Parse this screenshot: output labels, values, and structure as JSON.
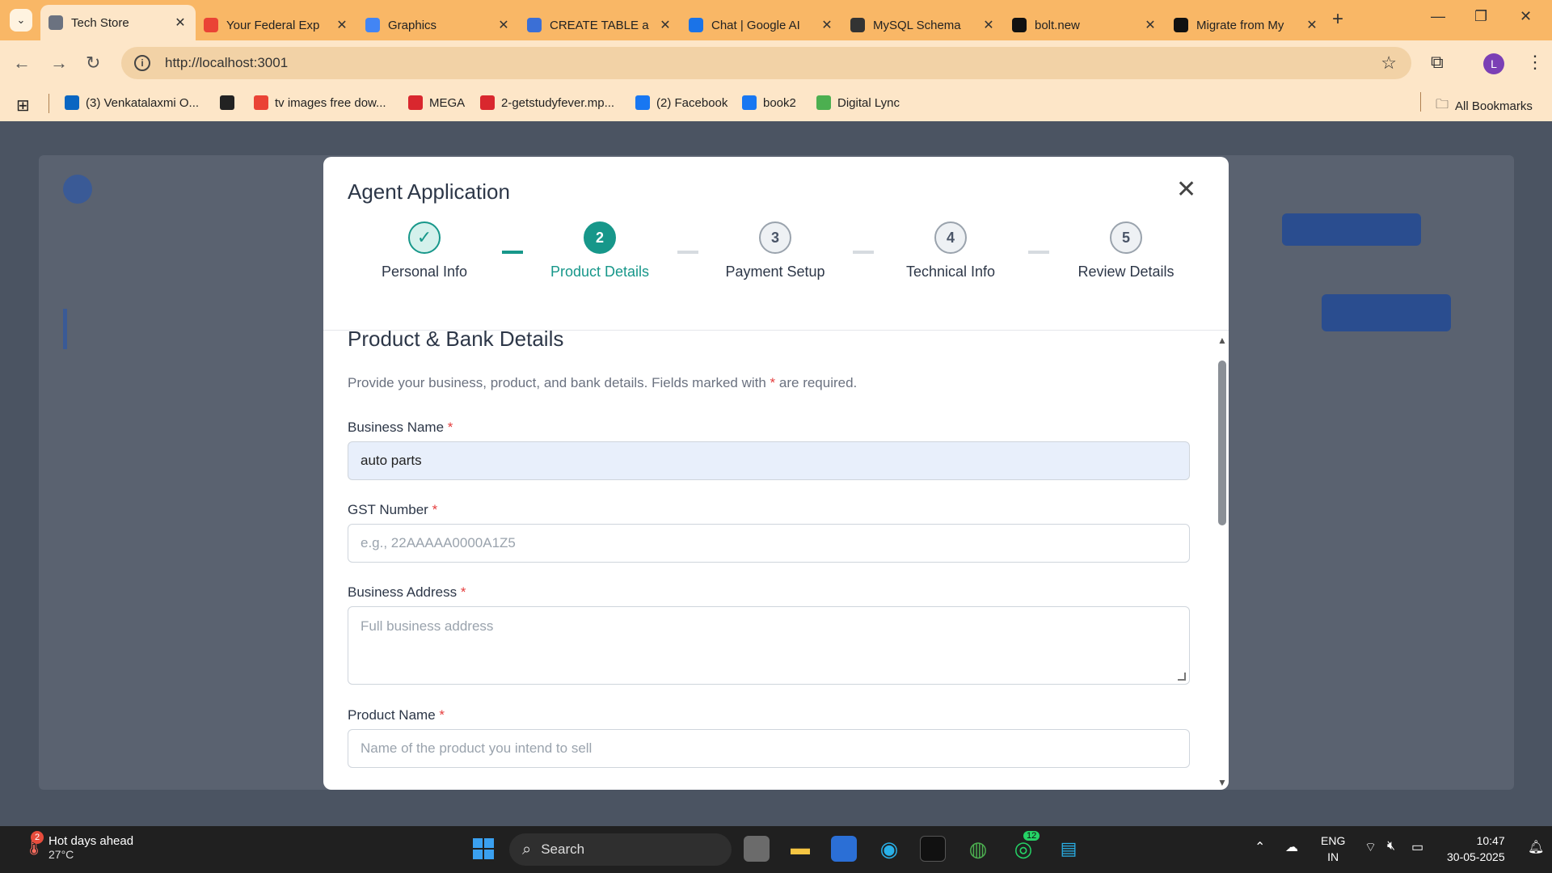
{
  "browser": {
    "tabs": [
      {
        "title": "Tech Store",
        "favicon": "globe-icon",
        "color": "#6b7280",
        "active": true
      },
      {
        "title": "Your Federal Exp",
        "favicon": "gmail-icon",
        "color": "#ea4335",
        "active": false
      },
      {
        "title": "Graphics",
        "favicon": "colab-icon",
        "color": "#4285f4",
        "active": false
      },
      {
        "title": "CREATE TABLE a",
        "favicon": "bot-icon",
        "color": "#3b6fd6",
        "active": false
      },
      {
        "title": "Chat | Google AI",
        "favicon": "butterfly-icon",
        "color": "#1a73e8",
        "active": false
      },
      {
        "title": "MySQL Schema",
        "favicon": "openai-icon",
        "color": "#333333",
        "active": false
      },
      {
        "title": "bolt.new",
        "favicon": "bolt-icon",
        "color": "#111111",
        "active": false
      },
      {
        "title": "Migrate from My",
        "favicon": "bolt-icon",
        "color": "#111111",
        "active": false
      }
    ],
    "url": "http://localhost:3001",
    "profile_initial": "L",
    "bookmarks": [
      {
        "label": "(3) Venkatalaxmi O...",
        "icon": "linkedin-icon",
        "color": "#0a66c2"
      },
      {
        "label": "",
        "icon": "globe-icon",
        "color": "#222222"
      },
      {
        "label": "tv images free dow...",
        "icon": "google-icon",
        "color": "#ea4335"
      },
      {
        "label": "MEGA",
        "icon": "mega-icon",
        "color": "#d9272e"
      },
      {
        "label": "2-getstudyfever.mp...",
        "icon": "mega-icon",
        "color": "#d9272e"
      },
      {
        "label": "(2) Facebook",
        "icon": "facebook-icon",
        "color": "#1877f2"
      },
      {
        "label": "book2",
        "icon": "facebook-icon",
        "color": "#1877f2"
      },
      {
        "label": "Digital Lync",
        "icon": "lync-icon",
        "color": "#4caf50"
      }
    ],
    "all_bookmarks": "All Bookmarks"
  },
  "modal": {
    "title": "Agent Application",
    "steps": [
      {
        "num": "✓",
        "label": "Personal Info",
        "state": "done"
      },
      {
        "num": "2",
        "label": "Product Details",
        "state": "current"
      },
      {
        "num": "3",
        "label": "Payment Setup",
        "state": "pending"
      },
      {
        "num": "4",
        "label": "Technical Info",
        "state": "pending"
      },
      {
        "num": "5",
        "label": "Review Details",
        "state": "pending"
      }
    ],
    "section_title": "Product & Bank Details",
    "section_desc_before": "Provide your business, product, and bank details. Fields marked with ",
    "section_desc_star": "*",
    "section_desc_after": " are required.",
    "fields": {
      "business_name": {
        "label": "Business Name",
        "value": "auto parts"
      },
      "gst_number": {
        "label": "GST Number",
        "placeholder": "e.g., 22AAAAA0000A1Z5"
      },
      "business_address": {
        "label": "Business Address",
        "placeholder": "Full business address"
      },
      "product_name": {
        "label": "Product Name",
        "placeholder": "Name of the product you intend to sell"
      }
    },
    "required_mark": "*"
  },
  "taskbar": {
    "weather_title": "Hot days ahead",
    "weather_temp": "27°C",
    "weather_badge": "2",
    "search_label": "Search",
    "whatsapp_badge": "12",
    "lang_line1": "ENG",
    "lang_line2": "IN",
    "time": "10:47",
    "date": "30-05-2025"
  }
}
